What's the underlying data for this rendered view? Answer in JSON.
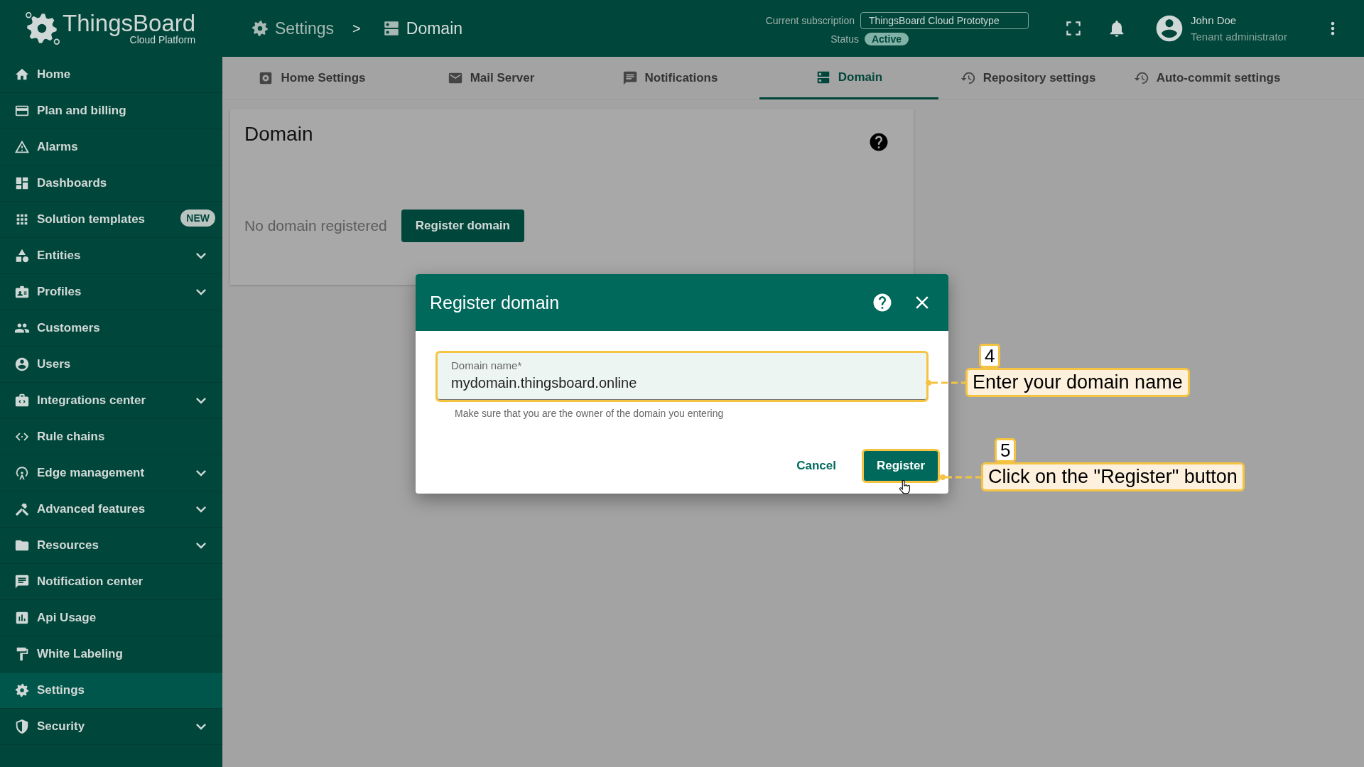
{
  "header": {
    "logo": {
      "name": "ThingsBoard",
      "subtitle": "Cloud Platform"
    },
    "breadcrumbs": [
      {
        "label": "Settings"
      },
      {
        "label": "Domain"
      }
    ],
    "breadcrumb_separator": ">",
    "subscription_label": "Current subscription",
    "subscription": "ThingsBoard Cloud Prototype",
    "status_label": "Status",
    "status": "Active",
    "user": {
      "name": "John Doe",
      "role": "Tenant administrator"
    }
  },
  "sidebar": {
    "items": [
      {
        "label": "Home",
        "expandable": false,
        "selected": false
      },
      {
        "label": "Plan and billing",
        "expandable": false,
        "selected": false
      },
      {
        "label": "Alarms",
        "expandable": false,
        "selected": false
      },
      {
        "label": "Dashboards",
        "expandable": false,
        "selected": false
      },
      {
        "label": "Solution templates",
        "expandable": false,
        "selected": false,
        "badge": "NEW"
      },
      {
        "label": "Entities",
        "expandable": true,
        "selected": false
      },
      {
        "label": "Profiles",
        "expandable": true,
        "selected": false
      },
      {
        "label": "Customers",
        "expandable": false,
        "selected": false
      },
      {
        "label": "Users",
        "expandable": false,
        "selected": false
      },
      {
        "label": "Integrations center",
        "expandable": true,
        "selected": false
      },
      {
        "label": "Rule chains",
        "expandable": false,
        "selected": false
      },
      {
        "label": "Edge management",
        "expandable": true,
        "selected": false
      },
      {
        "label": "Advanced features",
        "expandable": true,
        "selected": false
      },
      {
        "label": "Resources",
        "expandable": true,
        "selected": false
      },
      {
        "label": "Notification center",
        "expandable": false,
        "selected": false
      },
      {
        "label": "Api Usage",
        "expandable": false,
        "selected": false
      },
      {
        "label": "White Labeling",
        "expandable": false,
        "selected": false
      },
      {
        "label": "Settings",
        "expandable": false,
        "selected": true
      },
      {
        "label": "Security",
        "expandable": true,
        "selected": false
      }
    ]
  },
  "tabs": [
    {
      "label": "Home Settings",
      "selected": false
    },
    {
      "label": "Mail Server",
      "selected": false
    },
    {
      "label": "Notifications",
      "selected": false
    },
    {
      "label": "Domain",
      "selected": true
    },
    {
      "label": "Repository settings",
      "selected": false
    },
    {
      "label": "Auto-commit settings",
      "selected": false
    }
  ],
  "card": {
    "title": "Domain",
    "empty_text": "No domain registered",
    "button": "Register domain"
  },
  "dialog": {
    "title": "Register domain",
    "field": {
      "label": "Domain name*",
      "value": "mydomain.thingsboard.online",
      "hint": "Make sure that you are the owner of the domain you entering"
    },
    "buttons": [
      {
        "label": "Cancel",
        "kind": "text"
      },
      {
        "label": "Register",
        "kind": "primary"
      }
    ]
  },
  "callouts": [
    {
      "step": "4",
      "text": "Enter your domain name"
    },
    {
      "step": "5",
      "text": "Click on the \"Register\" button"
    }
  ]
}
